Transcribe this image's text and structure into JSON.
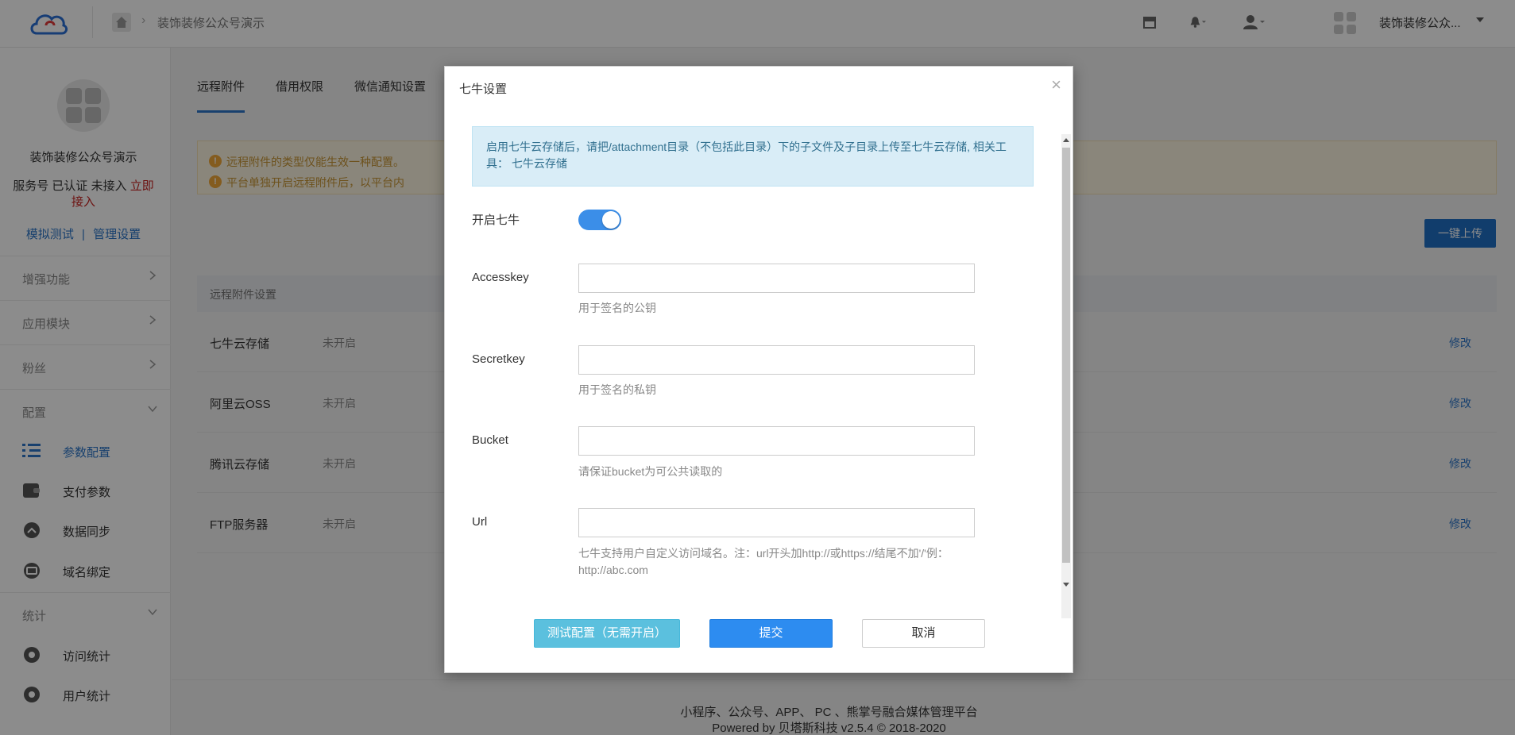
{
  "topbar": {
    "breadcrumb": "装饰装修公众号演示",
    "account_name": "装饰装修公众...",
    "icons": [
      "cloud-logo-icon",
      "home-icon",
      "store-icon",
      "bell-icon",
      "user-icon",
      "apps-icon"
    ]
  },
  "sidebar": {
    "account_name": "装饰装修公众号演示",
    "status_prefix": "服务号 已认证 未接入",
    "status_link": "立即接入",
    "link_test": "模拟测试",
    "link_separator": "|",
    "link_manage": "管理设置",
    "groups": {
      "enhance": "增强功能",
      "modules": "应用模块",
      "fans": "粉丝",
      "config": "配置",
      "stats": "统计"
    },
    "items": {
      "params": "参数配置",
      "payment": "支付参数",
      "sync": "数据同步",
      "domain": "域名绑定",
      "visit_stats": "访问统计",
      "user_stats": "用户统计"
    }
  },
  "main": {
    "tabs": [
      "远程附件",
      "借用权限",
      "微信通知设置"
    ],
    "notices": [
      "远程附件的类型仅能生效一种配置。",
      "平台单独开启远程附件后，以平台内"
    ],
    "upload_button": "一键上传",
    "settings_header": "远程附件设置",
    "rows": [
      {
        "name": "七牛云存储",
        "state": "未开启",
        "action": "修改"
      },
      {
        "name": "阿里云OSS",
        "state": "未开启",
        "action": "修改"
      },
      {
        "name": "腾讯云存储",
        "state": "未开启",
        "action": "修改"
      },
      {
        "name": "FTP服务器",
        "state": "未开启",
        "action": "修改"
      }
    ],
    "footer_line1": "小程序、公众号、APP、 PC 、熊掌号融合媒体管理平台",
    "footer_line2": "Powered by 贝塔斯科技 v2.5.4 © 2018-2020"
  },
  "modal": {
    "title": "七牛设置",
    "close": "×",
    "info": "启用七牛云存储后，请把/attachment目录（不包括此目录）下的子文件及子目录上传至七牛云存储, 相关工具： 七牛云存储",
    "toggle_label": "开启七牛",
    "toggle_on": true,
    "fields": {
      "accesskey": {
        "label": "Accesskey",
        "value": "",
        "help": "用于签名的公钥"
      },
      "secretkey": {
        "label": "Secretkey",
        "value": "",
        "help": "用于签名的私钥"
      },
      "bucket": {
        "label": "Bucket",
        "value": "",
        "help": "请保证bucket为可公共读取的"
      },
      "url": {
        "label": "Url",
        "value": "",
        "help": "七牛支持用户自定义访问域名。注：url开头加http://或https://结尾不加'/'例：http://abc.com"
      }
    },
    "buttons": {
      "test": "测试配置（无需开启）",
      "submit": "提交",
      "cancel": "取消"
    }
  },
  "colors": {
    "accent": "#2c76c8",
    "toggle": "#3b8ee8",
    "info_bg": "#d9edf7",
    "warning": "#f0a83a"
  }
}
